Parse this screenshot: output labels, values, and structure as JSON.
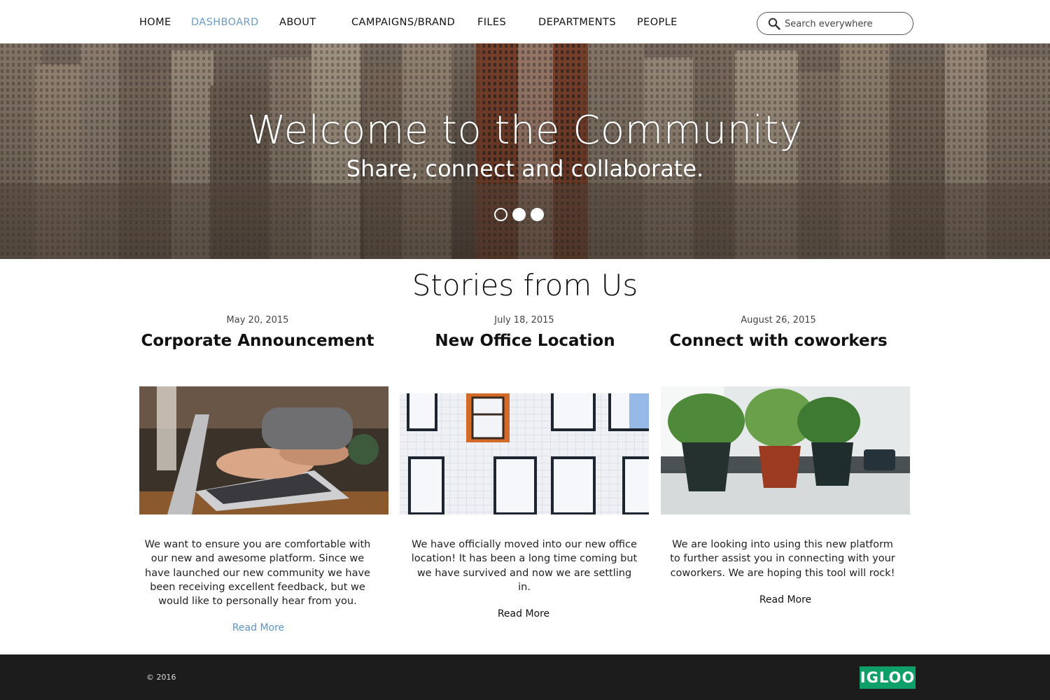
{
  "nav": {
    "items": [
      {
        "label": "HOME"
      },
      {
        "label": "DASHBOARD"
      },
      {
        "label": "ABOUT"
      },
      {
        "label": "CAMPAIGNS/BRAND"
      },
      {
        "label": "FILES"
      },
      {
        "label": "DEPARTMENTS"
      },
      {
        "label": "PEOPLE"
      }
    ],
    "active": "DASHBOARD",
    "search_placeholder": "Search everywhere"
  },
  "hero": {
    "title": "Welcome to the Community",
    "subtitle": "Share, connect and collaborate.",
    "slides_total": 3,
    "active_slide": 1
  },
  "stories": {
    "heading": "Stories from Us",
    "cards": [
      {
        "date": "May 20, 2015",
        "title": "Corporate Announcement",
        "image": "laptop-typing-photo",
        "body": "We want to ensure you are comfortable with our new and awesome platform. Since we have launched our new community we have been receiving excellent feedback, but we would like to personally hear from you.",
        "cta": "Read More"
      },
      {
        "date": "July 18, 2015",
        "title": "New Office Location",
        "image": "building-windows-photo",
        "body": "We have officially moved into our new office location! It has been a long time coming but we have survived and now we are settling in.",
        "cta": "Read More"
      },
      {
        "date": "August 26, 2015",
        "title": "Connect with coworkers",
        "image": "potted-plants-photo",
        "body": "We are looking into using this new platform to further assist you in connecting with your coworkers. We are hoping this tool will rock!",
        "cta": "Read More"
      }
    ]
  },
  "footer": {
    "copyright": "© 2016",
    "logo": "IGLOO"
  },
  "colors": {
    "nav_active": "#6a9bc9",
    "link": "#5a94c8",
    "footer_bg": "#1c1c1c",
    "logo_bg": "#0ea068"
  },
  "icons": {
    "search": "search-icon"
  }
}
